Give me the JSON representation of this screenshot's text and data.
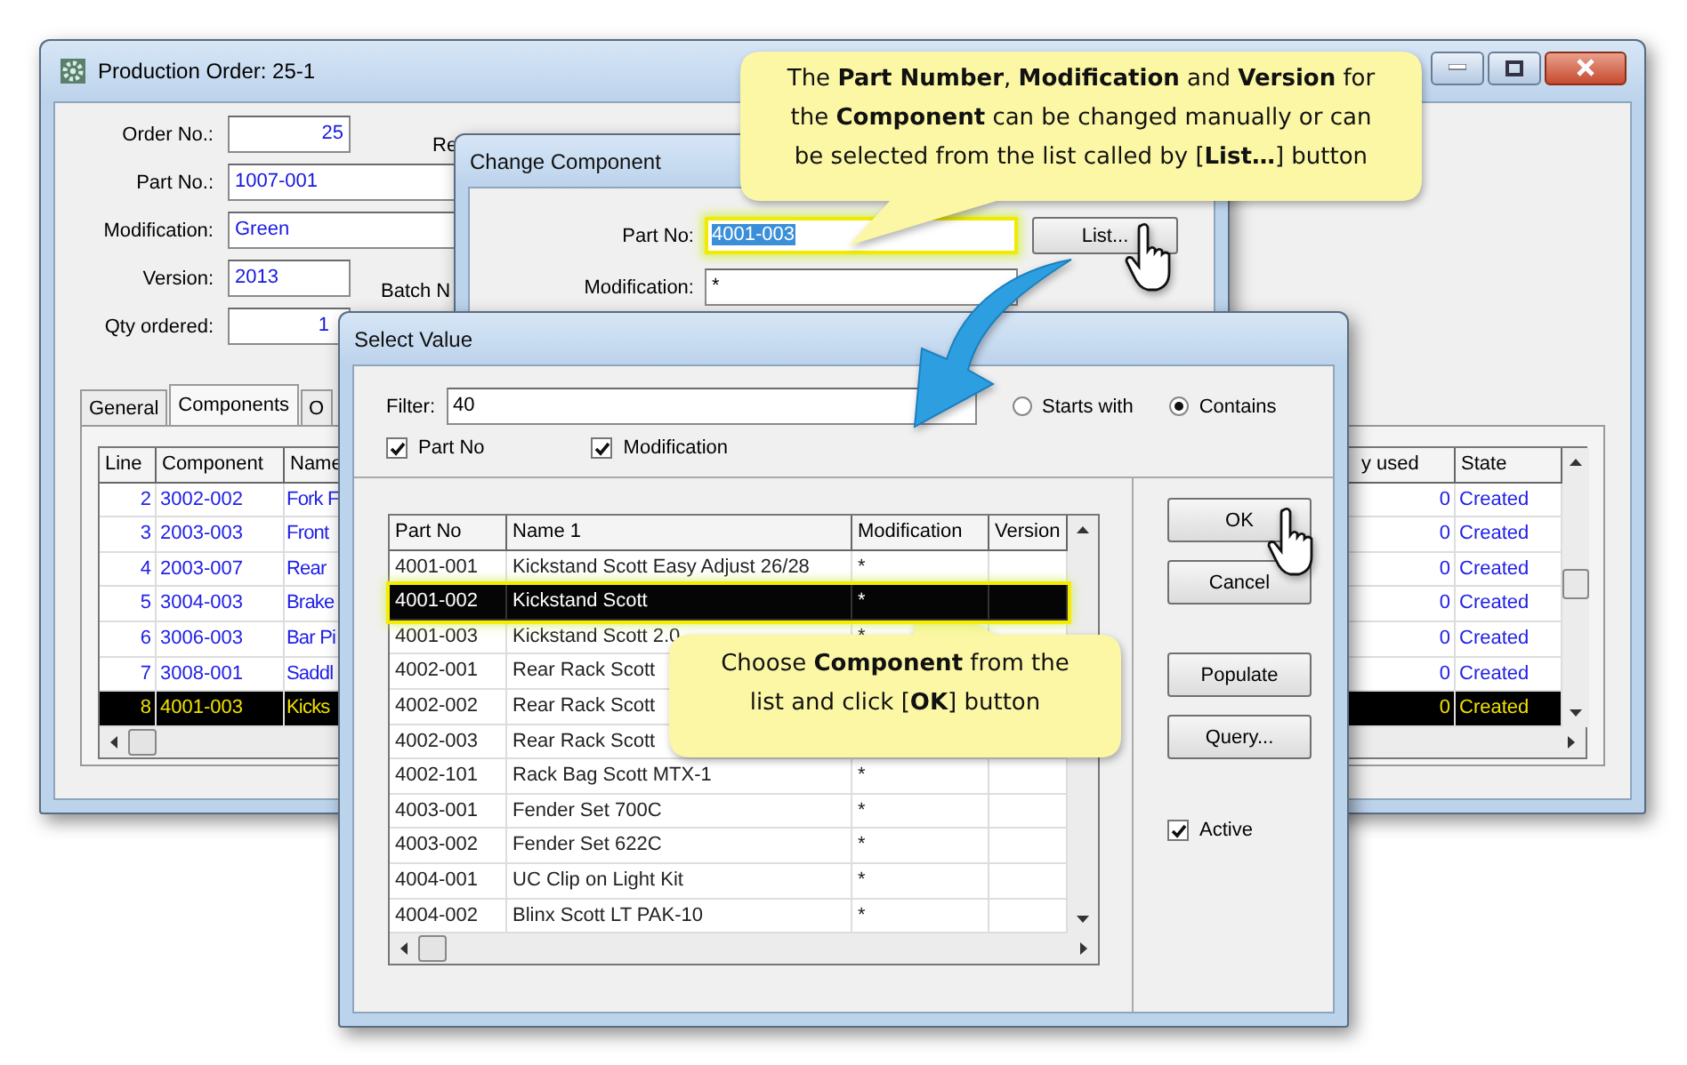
{
  "main_window": {
    "title": "Production Order: 25-1",
    "fields": [
      {
        "label": "Order No.:",
        "value": "25"
      },
      {
        "label": "Part No.:",
        "value": "1007-001"
      },
      {
        "label": "Modification:",
        "value": "Green"
      },
      {
        "label": "Version:",
        "value": "2013"
      },
      {
        "label": "Qty ordered:",
        "value": "1"
      }
    ],
    "cut_labels": [
      "Re",
      "Batch N"
    ],
    "tabs": [
      {
        "label": "General",
        "selected": false
      },
      {
        "label": "Components",
        "selected": true
      },
      {
        "label": "O",
        "selected": false
      }
    ],
    "table": {
      "columns": [
        "Line",
        "Component",
        "Name",
        "y used",
        "State"
      ],
      "rows": [
        {
          "line": "2",
          "component": "3002-002",
          "name": "Fork F",
          "used": "0",
          "state": "Created",
          "selected": false
        },
        {
          "line": "3",
          "component": "2003-003",
          "name": "Front",
          "used": "0",
          "state": "Created",
          "selected": false
        },
        {
          "line": "4",
          "component": "2003-007",
          "name": "Rear",
          "used": "0",
          "state": "Created",
          "selected": false
        },
        {
          "line": "5",
          "component": "3004-003",
          "name": "Brake",
          "used": "0",
          "state": "Created",
          "selected": false
        },
        {
          "line": "6",
          "component": "3006-003",
          "name": "Bar Pi",
          "used": "0",
          "state": "Created",
          "selected": false
        },
        {
          "line": "7",
          "component": "3008-001",
          "name": "Saddl",
          "used": "0",
          "state": "Created",
          "selected": false
        },
        {
          "line": "8",
          "component": "4001-003",
          "name": "Kicks",
          "used": "0",
          "state": "Created",
          "selected": true
        }
      ]
    }
  },
  "change_dialog": {
    "title": "Change Component",
    "fields": [
      {
        "label": "Part No:",
        "value": "4001-003",
        "highlighted": true
      },
      {
        "label": "Modification:",
        "value": "*",
        "highlighted": false
      }
    ],
    "list_button": "List..."
  },
  "select_dialog": {
    "title": "Select Value",
    "filter_label": "Filter:",
    "filter_value": "40",
    "radios": [
      {
        "label": "Starts with",
        "selected": false
      },
      {
        "label": "Contains",
        "selected": true
      }
    ],
    "checks": [
      {
        "label": "Part No",
        "checked": true
      },
      {
        "label": "Modification",
        "checked": true
      }
    ],
    "columns": [
      "Part No",
      "Name 1",
      "Modification",
      "Version"
    ],
    "rows": [
      {
        "part_no": "4001-001",
        "name": "Kickstand Scott Easy Adjust 26/28",
        "modification": "*",
        "selected": false
      },
      {
        "part_no": "4001-002",
        "name": "Kickstand Scott",
        "modification": "*",
        "selected": true
      },
      {
        "part_no": "4001-003",
        "name": "Kickstand Scott 2.0",
        "modification": "*",
        "selected": false
      },
      {
        "part_no": "4002-001",
        "name": "Rear Rack Scott",
        "selected": false
      },
      {
        "part_no": "4002-002",
        "name": "Rear Rack Scott",
        "selected": false
      },
      {
        "part_no": "4002-003",
        "name": "Rear Rack Scott",
        "selected": false
      },
      {
        "part_no": "4002-101",
        "name": "Rack Bag Scott MTX-1",
        "modification": "*",
        "selected": false
      },
      {
        "part_no": "4003-001",
        "name": "Fender Set 700C",
        "modification": "*",
        "selected": false
      },
      {
        "part_no": "4003-002",
        "name": "Fender Set 622C",
        "modification": "*",
        "selected": false
      },
      {
        "part_no": "4004-001",
        "name": "UC Clip on Light Kit",
        "modification": "*",
        "selected": false
      },
      {
        "part_no": "4004-002",
        "name": "Blinx Scott LT PAK-10",
        "modification": "*",
        "selected": false
      }
    ],
    "buttons": [
      {
        "label": "OK",
        "kind": "ok"
      },
      {
        "label": "Cancel",
        "kind": "cancel"
      },
      {
        "label": "Populate",
        "kind": "extra"
      },
      {
        "label": "Query...",
        "kind": "extra"
      }
    ],
    "active": {
      "label": "Active",
      "checked": true
    }
  },
  "callouts": [
    {
      "lines": [
        "The **Part Number**, **Modification** and **Version** for",
        "the **Component** can be changed manually or can",
        "be selected from the list called by [**List…**] button"
      ]
    },
    {
      "lines": [
        "Choose **Component** from the",
        "list and click [**OK**] button"
      ]
    }
  ]
}
